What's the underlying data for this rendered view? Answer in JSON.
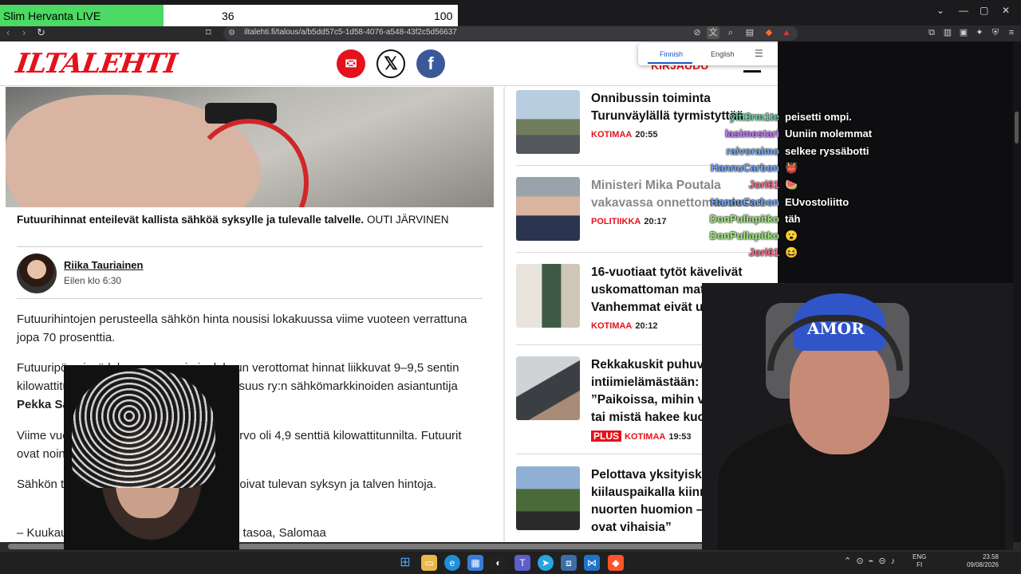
{
  "overlay": {
    "title": "Slim Hervanta LIVE",
    "current": "36",
    "max": "100",
    "progress_percent": 36
  },
  "browser": {
    "url": "iltalehti.fi/talous/a/b5dd57c5-1d58-4076-a548-43f2c5d56637",
    "translate": {
      "from": "Finnish",
      "to": "English"
    }
  },
  "header": {
    "logo": "ILTALEHTI",
    "login": "KIRJAUDU",
    "social": [
      "email-icon",
      "x-icon",
      "facebook-icon"
    ]
  },
  "article": {
    "caption_bold": "Futuurihinnat enteilevät kallista sähköä syksylle ja tulevalle talvelle.",
    "caption_credit": "OUTI JÄRVINEN",
    "author": "Riika Tauriainen",
    "time": "Eilen klo 6:30",
    "p1": "Futuurihintojen perusteella sähkön hinta nousisi lokakuussa viime vuoteen verrattuna jopa 70 prosenttia.",
    "p2a": "Futuuripörssissä loka-, marras- ja joulukuun verottomat hinnat liikkuvat 9–9,5 sentin kilowattituntihinnassa, kertoo Energiateollisuus ry:n sähkömarkkinoiden asiantuntija ",
    "p2b": "Pekka Salomaa",
    "p3": "Viime vuoden lokakuun aluehinnan keskiarvo oli 4,9 senttiä kilowattitunnilta. Futuurit ovat noin 70 prosenttia korkeammalla.",
    "p4": "Sähkön tulevaisuuden futuurihinnat ennakoivat tulevan syksyn ja talven hintoja.",
    "p5": "– Kuukausihinnan odotetaan noin 9 sentin tasoa, Salomaa"
  },
  "news": [
    {
      "title": "Onnibussin toiminta Turunväylällä tyrmistyttää",
      "category": "KOTIMAA",
      "time": "20:55",
      "plus": ""
    },
    {
      "title": "Ministeri Mika Poutala vakavassa onnettomuudessa",
      "category": "POLITIIKKA",
      "time": "20:17",
      "plus": ""
    },
    {
      "title": "16-vuotiaat tytöt kävelivät uskomattoman matkan – Vanhemmat eivät uskoneet",
      "category": "KOTIMAA",
      "time": "20:12",
      "plus": ""
    },
    {
      "title": "Rekkakuskit puhuvat nyt intiimielämästään: ”Paikoissa, mihin vie kuormia tai mistä hakee kuormia”",
      "category": "KOTIMAA",
      "time": "19:53",
      "plus": "PLUS"
    },
    {
      "title": "Pelottava yksityiskohta kiilauspaikalla kiinnitti nuorten huomion – ”Kaikki ovat vihaisia”",
      "category": "",
      "time": "",
      "plus": ""
    }
  ],
  "chat": [
    {
      "name": "yltt3rm1te",
      "msg": "peisetti ompi.",
      "color": "#5fd3a0"
    },
    {
      "name": "lasimestari",
      "msg": "Uuniin molemmat",
      "color": "#c77dff"
    },
    {
      "name": "raivoraimo",
      "msg": "selkee ryssäbotti",
      "color": "#6fa8ff"
    },
    {
      "name": "HannuCarbon",
      "msg": "👹",
      "color": "#6fa8ff"
    },
    {
      "name": "Jori61",
      "msg": "🍉",
      "color": "#ff6b8b"
    },
    {
      "name": "HannuCarbon",
      "msg": "EUvostoliitto",
      "color": "#6fa8ff"
    },
    {
      "name": "DonPullapitko",
      "msg": "täh",
      "color": "#9ff07a"
    },
    {
      "name": "DonPullapitko",
      "msg": "😮",
      "color": "#9ff07a"
    },
    {
      "name": "Jori61",
      "msg": "😆",
      "color": "#ff6b8b"
    }
  ],
  "webcam": {
    "cap_text": "AMOR"
  },
  "taskbar": {
    "lang": "ENG",
    "region": "FI",
    "time": "23.58",
    "date": "09/08/2026"
  }
}
